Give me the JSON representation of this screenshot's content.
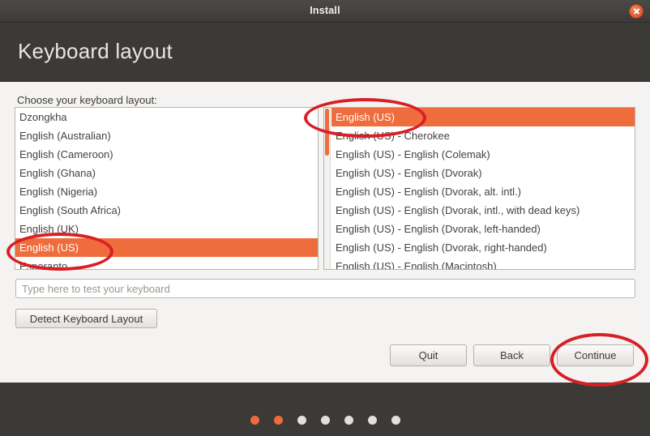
{
  "window": {
    "title": "Install",
    "close_icon": "close-icon"
  },
  "header": {
    "page_title": "Keyboard layout"
  },
  "main": {
    "choose_label": "Choose your keyboard layout:",
    "left_list": {
      "selected": "English (US)",
      "items": [
        "Dzongkha",
        "English (Australian)",
        "English (Cameroon)",
        "English (Ghana)",
        "English (Nigeria)",
        "English (South Africa)",
        "English (UK)",
        "English (US)",
        "Esperanto"
      ]
    },
    "right_list": {
      "selected": "English (US)",
      "items": [
        "English (US)",
        "English (US) - Cherokee",
        "English (US) - English (Colemak)",
        "English (US) - English (Dvorak)",
        "English (US) - English (Dvorak, alt. intl.)",
        "English (US) - English (Dvorak, intl., with dead keys)",
        "English (US) - English (Dvorak, left-handed)",
        "English (US) - English (Dvorak, right-handed)",
        "English (US) - English (Macintosh)"
      ]
    },
    "test_input": {
      "placeholder": "Type here to test your keyboard",
      "value": ""
    },
    "detect_button": "Detect Keyboard Layout"
  },
  "actions": {
    "quit": "Quit",
    "back": "Back",
    "continue": "Continue"
  },
  "footer": {
    "dots_total": 7,
    "dots_active": 2
  },
  "colors": {
    "accent": "#ef6c3c",
    "header_bg": "#3b3a36",
    "content_bg": "#f4f3f1",
    "annotation": "#d81f26"
  }
}
